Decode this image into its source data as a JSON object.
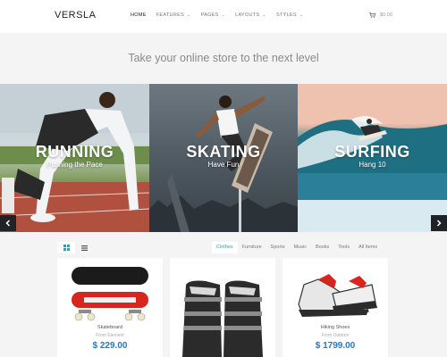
{
  "header": {
    "logo": "VERSLA",
    "nav": [
      {
        "label": "HOME",
        "dropdown": false
      },
      {
        "label": "FEATURES",
        "dropdown": true
      },
      {
        "label": "PAGES",
        "dropdown": true
      },
      {
        "label": "LAYOUTS",
        "dropdown": true
      },
      {
        "label": "STYLES",
        "dropdown": true
      }
    ],
    "cart_total": "$0.00"
  },
  "tagline": "Take your online store to the next level",
  "slides": [
    {
      "title": "RUNNING",
      "subtitle": "Pushing the Pace"
    },
    {
      "title": "SKATING",
      "subtitle": "Have Fun"
    },
    {
      "title": "SURFING",
      "subtitle": "Hang 10"
    }
  ],
  "filters": [
    "Clothes",
    "Furniture",
    "Sports",
    "Music",
    "Books",
    "Tools",
    "All Items"
  ],
  "products": [
    {
      "name": "Skateboard",
      "brand": "From Element",
      "price": "$ 229.00"
    },
    {
      "name": "",
      "brand": "",
      "price": ""
    },
    {
      "name": "Hiking Shoes",
      "brand": "From Outdoor",
      "price": "$ 1799.00"
    }
  ],
  "colors": {
    "accent": "#2aa3c2",
    "price": "#1e7bd0",
    "arrow_bg": "#1f2328"
  }
}
